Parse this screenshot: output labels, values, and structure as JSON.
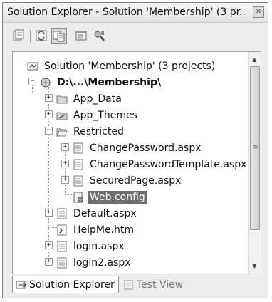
{
  "window": {
    "title": "Solution Explorer - Solution 'Membership' (3 pr..."
  },
  "toolbar": {
    "buttons": [
      {
        "icon": "properties-icon"
      },
      {
        "icon": "refresh-icon"
      },
      {
        "icon": "show-all-files-icon"
      },
      {
        "icon": "view-designer-icon"
      },
      {
        "icon": "asp-net-configuration-icon"
      }
    ]
  },
  "tree": {
    "items": [
      {
        "label": "Solution 'Membership' (3 projects)",
        "icon": "solution-icon"
      },
      {
        "label": "D:\\...\\Membership\\",
        "icon": "website-project-icon"
      },
      {
        "label": "App_Data",
        "icon": "folder-icon"
      },
      {
        "label": "App_Themes",
        "icon": "themes-folder-icon"
      },
      {
        "label": "Restricted",
        "icon": "open-folder-icon"
      },
      {
        "label": "ChangePassword.aspx",
        "icon": "aspx-file-icon"
      },
      {
        "label": "ChangePasswordTemplate.aspx",
        "icon": "aspx-file-icon"
      },
      {
        "label": "SecuredPage.aspx",
        "icon": "aspx-file-icon"
      },
      {
        "label": "Web.config",
        "icon": "config-file-icon"
      },
      {
        "label": "Default.aspx",
        "icon": "aspx-file-icon"
      },
      {
        "label": "HelpMe.htm",
        "icon": "html-file-icon"
      },
      {
        "label": "login.aspx",
        "icon": "aspx-file-icon"
      },
      {
        "label": "login2.aspx",
        "icon": "aspx-file-icon"
      }
    ]
  },
  "tabs": [
    {
      "label": "Solution Explorer",
      "icon": "solution-explorer-icon"
    },
    {
      "label": "Test View",
      "icon": "test-view-icon"
    }
  ]
}
